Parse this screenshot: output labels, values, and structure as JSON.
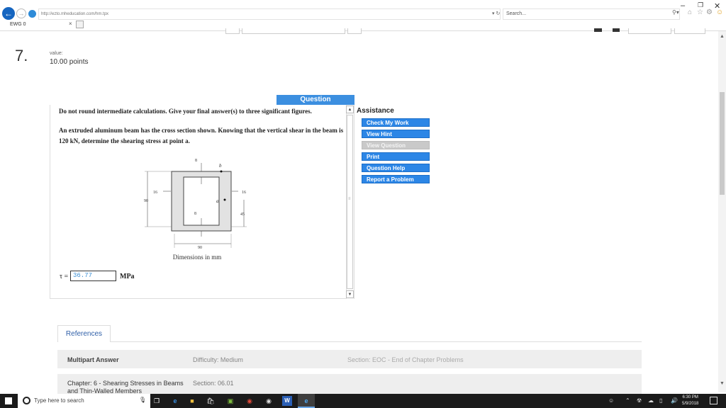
{
  "browser": {
    "url": "http://ezto.mheducation.com/hm.tpx",
    "search_placeholder": "Search...",
    "tab_title": "EWG 0",
    "tab_close": "×"
  },
  "question": {
    "number": "7.",
    "value_label": "value:",
    "points": "10.00 points",
    "tab_label": "Question",
    "instructions": "Do not round intermediate calculations. Give your final answer(s) to three significant figures.",
    "problem_text": "An extruded aluminum beam has the cross section shown. Knowing that the vertical shear in the beam is 120 kN, determine the shearing stress at point a.",
    "figure_caption": "Dimensions in mm",
    "answer_label": "τ =",
    "answer_value": "36.77",
    "answer_unit": "MPa"
  },
  "figure": {
    "labels": {
      "top_wall": "8",
      "point_b": "b",
      "left_wall": "16",
      "right_wall": "16",
      "height": "90",
      "point_a": "a",
      "lower_height": "45",
      "bottom_wall": "8",
      "width": "90"
    }
  },
  "assistance": {
    "title": "Assistance",
    "buttons": [
      {
        "label": "Check My Work",
        "enabled": true
      },
      {
        "label": "View Hint",
        "enabled": true
      },
      {
        "label": "View Question",
        "enabled": false
      },
      {
        "label": "Print",
        "enabled": true
      },
      {
        "label": "Question Help",
        "enabled": true
      },
      {
        "label": "Report a Problem",
        "enabled": true
      }
    ]
  },
  "references": {
    "tab_label": "References",
    "type": "Multipart Answer",
    "difficulty": "Difficulty: Medium",
    "section": "Section: EOC - End of Chapter Problems",
    "chapter": "Chapter: 6 - Shearing Stresses in Beams and Thin-Walled Members",
    "section_number": "Section: 06.01"
  },
  "taskbar": {
    "search_placeholder": "Type here to search",
    "time": "6:30 PM",
    "date": "5/9/2018"
  },
  "colors": {
    "accent_blue": "#2c86e6",
    "question_tab": "#3c8fe0",
    "answer_text": "#3b8fd4"
  }
}
